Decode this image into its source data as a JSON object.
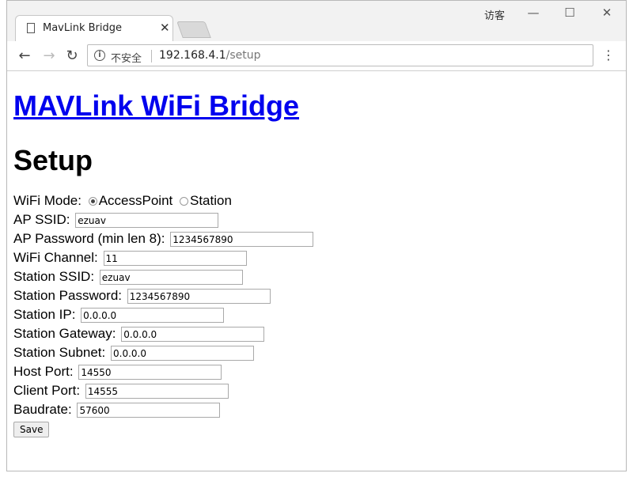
{
  "browser": {
    "tab_title": "MavLink Bridge",
    "tab_close": "✕",
    "guest_label": "访客",
    "security_label": "不安全",
    "url_host": "192.168.4.1",
    "url_path": "/setup",
    "minimize": "—",
    "maximize": "☐",
    "close": "✕"
  },
  "page": {
    "title": "MAVLink WiFi Bridge",
    "subtitle": "Setup",
    "wifi_mode_label": "WiFi Mode:",
    "mode_options": [
      "AccessPoint",
      "Station"
    ],
    "mode_selected": "AccessPoint",
    "fields": [
      {
        "label": "AP SSID:",
        "value": "ezuav"
      },
      {
        "label": "AP Password (min len 8):",
        "value": "1234567890"
      },
      {
        "label": "WiFi Channel:",
        "value": "11"
      },
      {
        "label": "Station SSID:",
        "value": "ezuav"
      },
      {
        "label": "Station Password:",
        "value": "1234567890"
      },
      {
        "label": "Station IP:",
        "value": "0.0.0.0"
      },
      {
        "label": "Station Gateway:",
        "value": "0.0.0.0"
      },
      {
        "label": "Station Subnet:",
        "value": "0.0.0.0"
      },
      {
        "label": "Host Port:",
        "value": "14550"
      },
      {
        "label": "Client Port:",
        "value": "14555"
      },
      {
        "label": "Baudrate:",
        "value": "57600"
      }
    ],
    "save_label": "Save"
  }
}
